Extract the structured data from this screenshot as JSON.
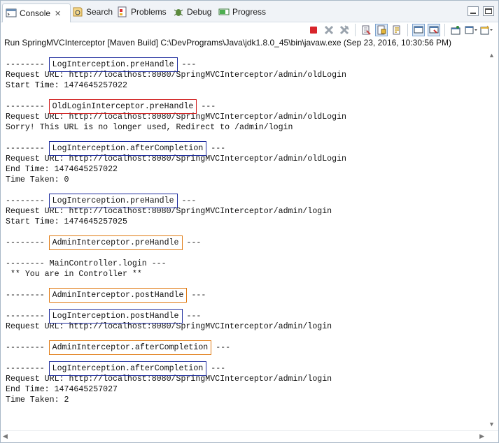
{
  "tabs": [
    {
      "label": "Console",
      "icon": "console-icon",
      "active": true
    },
    {
      "label": "Search",
      "icon": "search-icon"
    },
    {
      "label": "Problems",
      "icon": "problems-icon"
    },
    {
      "label": "Debug",
      "icon": "debug-icon"
    },
    {
      "label": "Progress",
      "icon": "progress-icon"
    }
  ],
  "toolbar": {
    "icons": [
      "terminate-icon",
      "remove-launch-icon",
      "remove-all-terminated-icon",
      "clear-console-icon",
      "scroll-lock-icon",
      "word-wrap-icon",
      "show-on-stdout-icon",
      "show-on-stderr-icon",
      "pin-console-icon",
      "display-console-icon",
      "open-console-icon"
    ]
  },
  "run_line": "Run SpringMVCInterceptor [Maven Build] C:\\DevPrograms\\Java\\jdk1.8.0_45\\bin\\javaw.exe (Sep 23, 2016, 10:30:56 PM)",
  "console": {
    "lines": [
      {
        "prefix": "-------- ",
        "boxed": "LogInterception.preHandle",
        "box": "blue",
        "suffix": " ---"
      },
      {
        "text": "Request URL: http://localhost:8080/SpringMVCInterceptor/admin/oldLogin"
      },
      {
        "text": "Start Time: 1474645257022"
      },
      {
        "text": ""
      },
      {
        "prefix": "-------- ",
        "boxed": "OldLoginInterceptor.preHandle",
        "box": "red",
        "suffix": " ---"
      },
      {
        "text": "Request URL: http://localhost:8080/SpringMVCInterceptor/admin/oldLogin"
      },
      {
        "text": "Sorry! This URL is no longer used, Redirect to /admin/login"
      },
      {
        "text": ""
      },
      {
        "prefix": "-------- ",
        "boxed": "LogInterception.afterCompletion",
        "box": "blue",
        "suffix": " ---"
      },
      {
        "text": "Request URL: http://localhost:8080/SpringMVCInterceptor/admin/oldLogin"
      },
      {
        "text": "End Time: 1474645257022"
      },
      {
        "text": "Time Taken: 0"
      },
      {
        "text": ""
      },
      {
        "prefix": "-------- ",
        "boxed": "LogInterception.preHandle",
        "box": "blue",
        "suffix": " ---"
      },
      {
        "text": "Request URL: http://localhost:8080/SpringMVCInterceptor/admin/login"
      },
      {
        "text": "Start Time: 1474645257025"
      },
      {
        "text": ""
      },
      {
        "prefix": "-------- ",
        "boxed": "AdminInterceptor.preHandle",
        "box": "orange",
        "suffix": " ---"
      },
      {
        "text": ""
      },
      {
        "text": "-------- MainController.login ---"
      },
      {
        "text": " ** You are in Controller **"
      },
      {
        "text": ""
      },
      {
        "prefix": "-------- ",
        "boxed": "AdminInterceptor.postHandle",
        "box": "orange",
        "suffix": " ---"
      },
      {
        "text": ""
      },
      {
        "prefix": "-------- ",
        "boxed": "LogInterception.postHandle",
        "box": "blue",
        "suffix": " ---"
      },
      {
        "text": "Request URL: http://localhost:8080/SpringMVCInterceptor/admin/login"
      },
      {
        "text": ""
      },
      {
        "prefix": "-------- ",
        "boxed": "AdminInterceptor.afterCompletion",
        "box": "orange",
        "suffix": " ---"
      },
      {
        "text": ""
      },
      {
        "prefix": "-------- ",
        "boxed": "LogInterception.afterCompletion",
        "box": "blue",
        "suffix": " ---"
      },
      {
        "text": "Request URL: http://localhost:8080/SpringMVCInterceptor/admin/login"
      },
      {
        "text": "End Time: 1474645257027"
      },
      {
        "text": "Time Taken: 2"
      }
    ]
  },
  "colors": {
    "box_blue": "#1f2d9e",
    "box_red": "#d01c1c",
    "box_orange": "#e07a12",
    "terminate": "#d8242b"
  }
}
